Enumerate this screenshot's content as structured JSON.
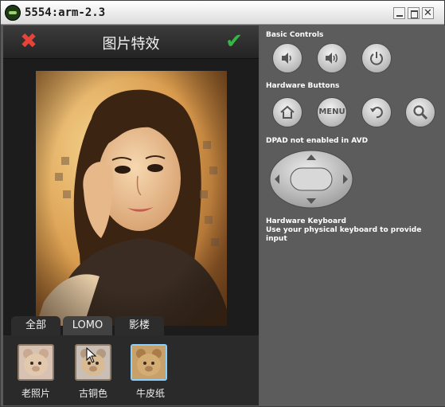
{
  "window": {
    "title": "5554:arm-2.3",
    "close_glyph": "✕"
  },
  "app": {
    "title": "图片特效",
    "cancel_icon": "close-icon",
    "confirm_icon": "check-icon",
    "cancel_glyph": "✖",
    "confirm_glyph": "✔",
    "tabs": [
      {
        "label": "全部"
      },
      {
        "label": "LOMO",
        "selected": true
      },
      {
        "label": "影楼"
      }
    ],
    "filters": [
      {
        "label": "老照片"
      },
      {
        "label": "古铜色"
      },
      {
        "label": "牛皮纸",
        "selected": true
      }
    ]
  },
  "controls": {
    "basic_controls_label": "Basic Controls",
    "hardware_buttons_label": "Hardware Buttons",
    "menu_label": "MENU",
    "dpad_label": "DPAD not enabled in AVD",
    "keyboard_label": "Hardware Keyboard",
    "keyboard_hint": "Use your physical keyboard to provide input"
  },
  "colors": {
    "cancel": "#e8433a",
    "confirm": "#35b843",
    "thumb_selected_border": "#8ad0ff"
  }
}
